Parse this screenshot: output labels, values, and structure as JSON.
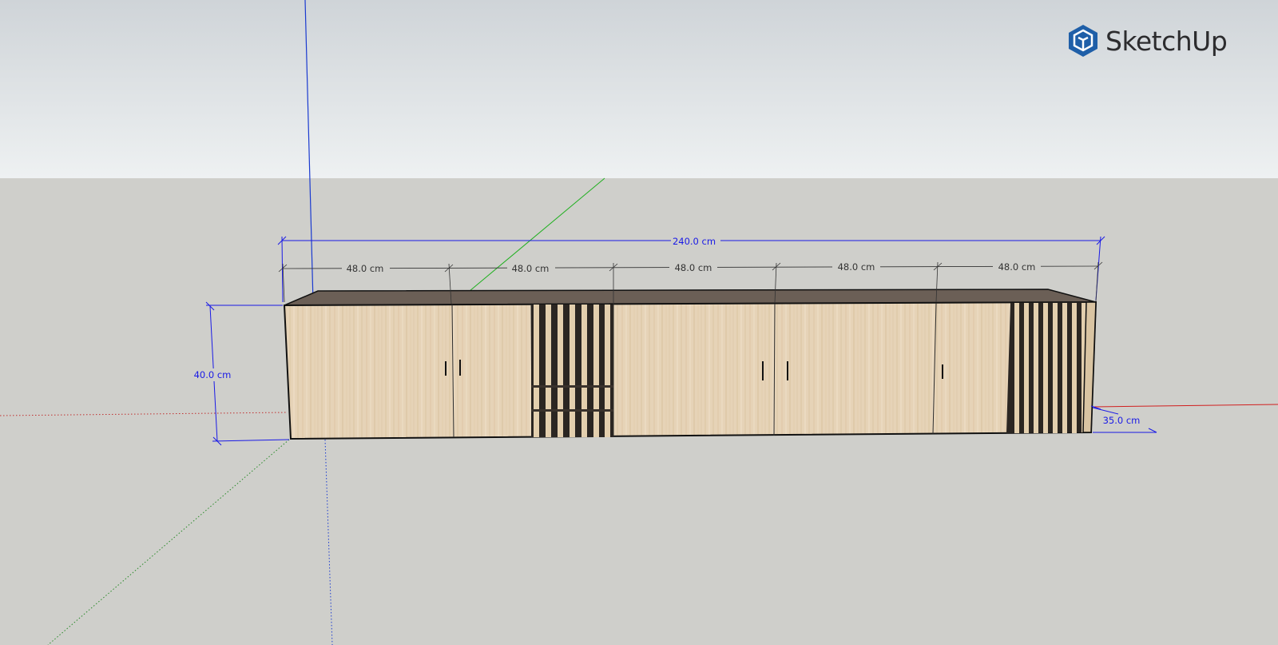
{
  "app": {
    "name": "SketchUp",
    "accent": "#1f5fa8"
  },
  "colors": {
    "sky_top": "#cfd4d8",
    "sky_bottom": "#eef1f2",
    "ground": "#cfcfcb",
    "wood_light": "#e8d6bc",
    "wood_dark": "#d6bf9e",
    "top_surface": "#6b5f56",
    "dimension_blue": "#1a1ae6",
    "dimension_gray": "#333333",
    "axis_red": "#d02020",
    "axis_green": "#20b020",
    "axis_blue": "#1a3ad0"
  },
  "dimensions": {
    "overall_width": "240.0 cm",
    "height": "40.0 cm",
    "depth": "35.0 cm",
    "segments": [
      "48.0 cm",
      "48.0 cm",
      "48.0 cm",
      "48.0 cm",
      "48.0 cm"
    ]
  },
  "model": {
    "name": "cabinet",
    "icon": "sketchup-logo-icon"
  }
}
